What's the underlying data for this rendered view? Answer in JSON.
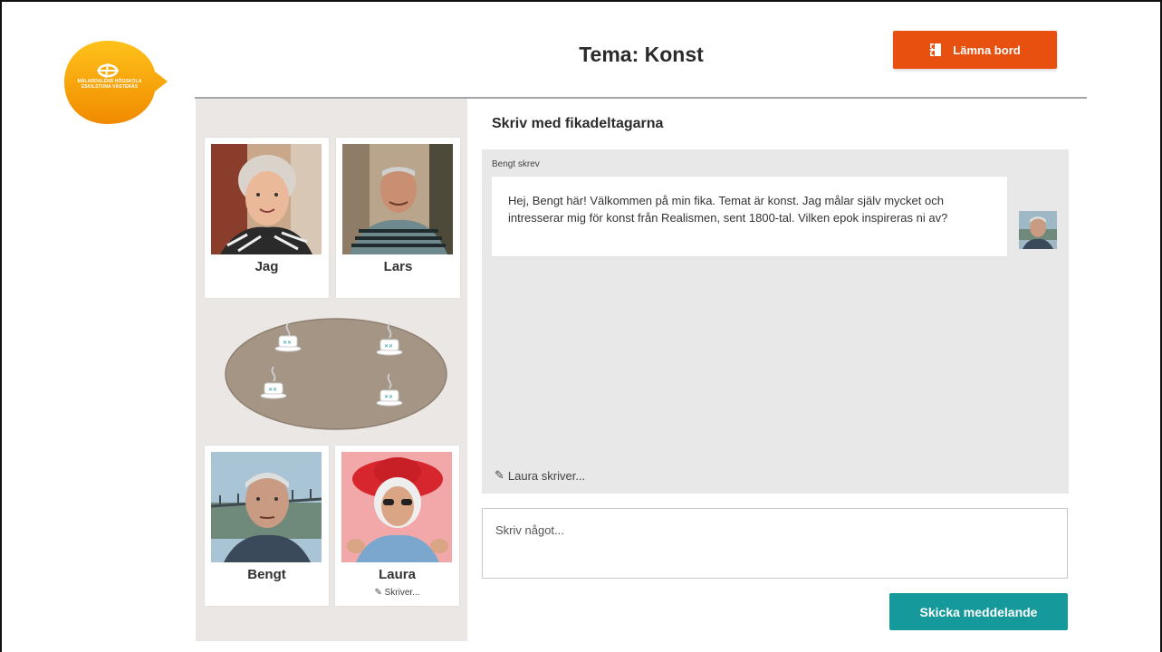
{
  "logo": {
    "name": "MÄLARDALENS HÖGSKOLA\nESKILSTUNA VÄSTERÅS",
    "color_top": "#ffc21a",
    "color_bottom": "#f08a00"
  },
  "header": {
    "title": "Tema: Konst",
    "leave_button": {
      "label": "Lämna bord",
      "icon": "door-exit-icon",
      "color": "#e8500f"
    }
  },
  "participants": [
    {
      "name": "Jag",
      "typing": ""
    },
    {
      "name": "Lars",
      "typing": ""
    },
    {
      "name": "Bengt",
      "typing": ""
    },
    {
      "name": "Laura",
      "typing": "Skriver..."
    }
  ],
  "table": {
    "cups": 4,
    "color": "#a59585",
    "icon": "coffee-cup-icon"
  },
  "chat": {
    "heading": "Skriv med fikadeltagarna",
    "messages": [
      {
        "author_label": "Bengt skrev",
        "text": "Hej, Bengt här! Välkommen på min fika. Temat är konst. Jag målar själv mycket och intresserar mig för konst från Realismen, sent 1800-tal. Vilken epok inspireras ni av?"
      }
    ],
    "typing_indicator": "Laura skriver..."
  },
  "composer": {
    "placeholder": "Skriv något...",
    "send_label": "Skicka meddelande",
    "send_color": "#16999a"
  }
}
